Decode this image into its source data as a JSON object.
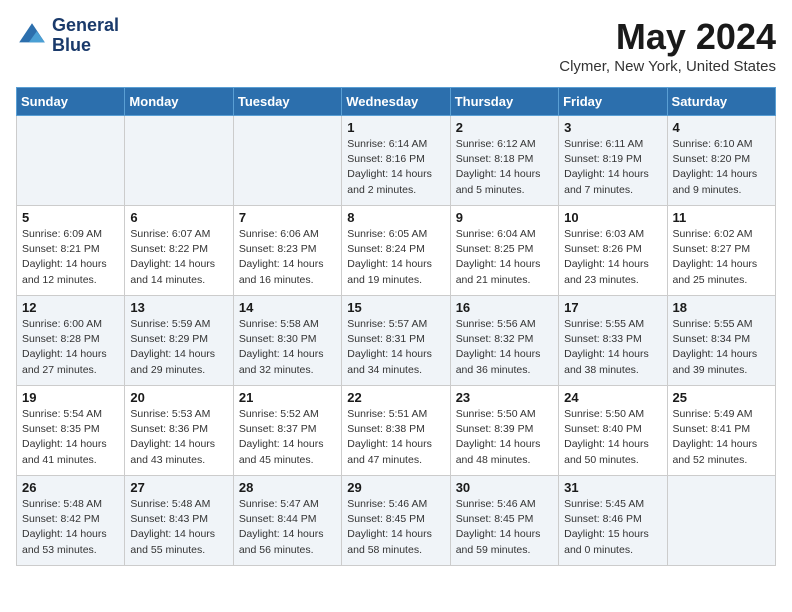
{
  "header": {
    "logo_line1": "General",
    "logo_line2": "Blue",
    "month": "May 2024",
    "location": "Clymer, New York, United States"
  },
  "weekdays": [
    "Sunday",
    "Monday",
    "Tuesday",
    "Wednesday",
    "Thursday",
    "Friday",
    "Saturday"
  ],
  "weeks": [
    [
      {
        "day": "",
        "empty": true
      },
      {
        "day": "",
        "empty": true
      },
      {
        "day": "",
        "empty": true
      },
      {
        "day": "1",
        "sunrise": "6:14 AM",
        "sunset": "8:16 PM",
        "daylight": "14 hours and 2 minutes."
      },
      {
        "day": "2",
        "sunrise": "6:12 AM",
        "sunset": "8:18 PM",
        "daylight": "14 hours and 5 minutes."
      },
      {
        "day": "3",
        "sunrise": "6:11 AM",
        "sunset": "8:19 PM",
        "daylight": "14 hours and 7 minutes."
      },
      {
        "day": "4",
        "sunrise": "6:10 AM",
        "sunset": "8:20 PM",
        "daylight": "14 hours and 9 minutes."
      }
    ],
    [
      {
        "day": "5",
        "sunrise": "6:09 AM",
        "sunset": "8:21 PM",
        "daylight": "14 hours and 12 minutes."
      },
      {
        "day": "6",
        "sunrise": "6:07 AM",
        "sunset": "8:22 PM",
        "daylight": "14 hours and 14 minutes."
      },
      {
        "day": "7",
        "sunrise": "6:06 AM",
        "sunset": "8:23 PM",
        "daylight": "14 hours and 16 minutes."
      },
      {
        "day": "8",
        "sunrise": "6:05 AM",
        "sunset": "8:24 PM",
        "daylight": "14 hours and 19 minutes."
      },
      {
        "day": "9",
        "sunrise": "6:04 AM",
        "sunset": "8:25 PM",
        "daylight": "14 hours and 21 minutes."
      },
      {
        "day": "10",
        "sunrise": "6:03 AM",
        "sunset": "8:26 PM",
        "daylight": "14 hours and 23 minutes."
      },
      {
        "day": "11",
        "sunrise": "6:02 AM",
        "sunset": "8:27 PM",
        "daylight": "14 hours and 25 minutes."
      }
    ],
    [
      {
        "day": "12",
        "sunrise": "6:00 AM",
        "sunset": "8:28 PM",
        "daylight": "14 hours and 27 minutes."
      },
      {
        "day": "13",
        "sunrise": "5:59 AM",
        "sunset": "8:29 PM",
        "daylight": "14 hours and 29 minutes."
      },
      {
        "day": "14",
        "sunrise": "5:58 AM",
        "sunset": "8:30 PM",
        "daylight": "14 hours and 32 minutes."
      },
      {
        "day": "15",
        "sunrise": "5:57 AM",
        "sunset": "8:31 PM",
        "daylight": "14 hours and 34 minutes."
      },
      {
        "day": "16",
        "sunrise": "5:56 AM",
        "sunset": "8:32 PM",
        "daylight": "14 hours and 36 minutes."
      },
      {
        "day": "17",
        "sunrise": "5:55 AM",
        "sunset": "8:33 PM",
        "daylight": "14 hours and 38 minutes."
      },
      {
        "day": "18",
        "sunrise": "5:55 AM",
        "sunset": "8:34 PM",
        "daylight": "14 hours and 39 minutes."
      }
    ],
    [
      {
        "day": "19",
        "sunrise": "5:54 AM",
        "sunset": "8:35 PM",
        "daylight": "14 hours and 41 minutes."
      },
      {
        "day": "20",
        "sunrise": "5:53 AM",
        "sunset": "8:36 PM",
        "daylight": "14 hours and 43 minutes."
      },
      {
        "day": "21",
        "sunrise": "5:52 AM",
        "sunset": "8:37 PM",
        "daylight": "14 hours and 45 minutes."
      },
      {
        "day": "22",
        "sunrise": "5:51 AM",
        "sunset": "8:38 PM",
        "daylight": "14 hours and 47 minutes."
      },
      {
        "day": "23",
        "sunrise": "5:50 AM",
        "sunset": "8:39 PM",
        "daylight": "14 hours and 48 minutes."
      },
      {
        "day": "24",
        "sunrise": "5:50 AM",
        "sunset": "8:40 PM",
        "daylight": "14 hours and 50 minutes."
      },
      {
        "day": "25",
        "sunrise": "5:49 AM",
        "sunset": "8:41 PM",
        "daylight": "14 hours and 52 minutes."
      }
    ],
    [
      {
        "day": "26",
        "sunrise": "5:48 AM",
        "sunset": "8:42 PM",
        "daylight": "14 hours and 53 minutes."
      },
      {
        "day": "27",
        "sunrise": "5:48 AM",
        "sunset": "8:43 PM",
        "daylight": "14 hours and 55 minutes."
      },
      {
        "day": "28",
        "sunrise": "5:47 AM",
        "sunset": "8:44 PM",
        "daylight": "14 hours and 56 minutes."
      },
      {
        "day": "29",
        "sunrise": "5:46 AM",
        "sunset": "8:45 PM",
        "daylight": "14 hours and 58 minutes."
      },
      {
        "day": "30",
        "sunrise": "5:46 AM",
        "sunset": "8:45 PM",
        "daylight": "14 hours and 59 minutes."
      },
      {
        "day": "31",
        "sunrise": "5:45 AM",
        "sunset": "8:46 PM",
        "daylight": "15 hours and 0 minutes."
      },
      {
        "day": "",
        "empty": true
      }
    ]
  ],
  "labels": {
    "sunrise_prefix": "Sunrise: ",
    "sunset_prefix": "Sunset: ",
    "daylight_label": "Daylight hours"
  }
}
